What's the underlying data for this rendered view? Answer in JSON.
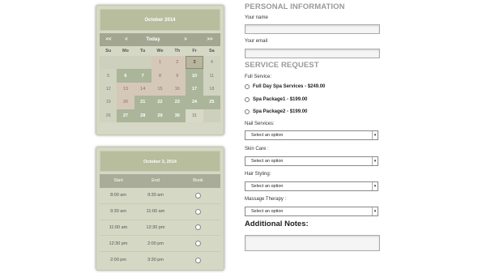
{
  "calendar": {
    "title": "October 2014",
    "nav": {
      "prev_year": "<<",
      "prev": "<",
      "today": "Today",
      "next": ">",
      "next_year": ">>"
    },
    "weekdays": [
      "Su",
      "Mo",
      "Tu",
      "We",
      "Th",
      "Fr",
      "Sa"
    ],
    "weeks": [
      [
        "",
        "",
        "",
        "1",
        "2",
        "3",
        "4"
      ],
      [
        "5",
        "6",
        "7",
        "8",
        "9",
        "10",
        "11"
      ],
      [
        "12",
        "13",
        "14",
        "15",
        "16",
        "17",
        "18"
      ],
      [
        "19",
        "20",
        "21",
        "22",
        "23",
        "24",
        "25"
      ],
      [
        "26",
        "27",
        "28",
        "29",
        "30",
        "31",
        ""
      ]
    ]
  },
  "slots": {
    "title": "October 3, 2014",
    "headers": {
      "start": "Start",
      "end": "End",
      "book": "Book"
    },
    "rows": [
      {
        "start": "8:00 am",
        "end": "9:30 am"
      },
      {
        "start": "9:30 am",
        "end": "11:00 am"
      },
      {
        "start": "11:00 am",
        "end": "12:30 pm"
      },
      {
        "start": "12:30 pm",
        "end": "2:00 pm"
      },
      {
        "start": "2:00 pm",
        "end": "3:30 pm"
      }
    ]
  },
  "form": {
    "personal_title": "PERSONAL INFORMATION",
    "name_label": "Your name",
    "email_label": "Your email",
    "service_title": "SERVICE REQUEST",
    "full_service_label": "Full Service:",
    "options": [
      "Full Day Spa Services - $249.00",
      "Spa Package1 - $199.00",
      "Spa Package2 - $199.00"
    ],
    "selects": [
      {
        "label": "Nail Services:",
        "value": "Select an option"
      },
      {
        "label": "Skin Care :",
        "value": "Select an option"
      },
      {
        "label": "Hair Styling:",
        "value": "Select an option"
      },
      {
        "label": "Massage Therapy :",
        "value": "Select an option"
      }
    ],
    "notes_title": "Additional Notes:"
  }
}
